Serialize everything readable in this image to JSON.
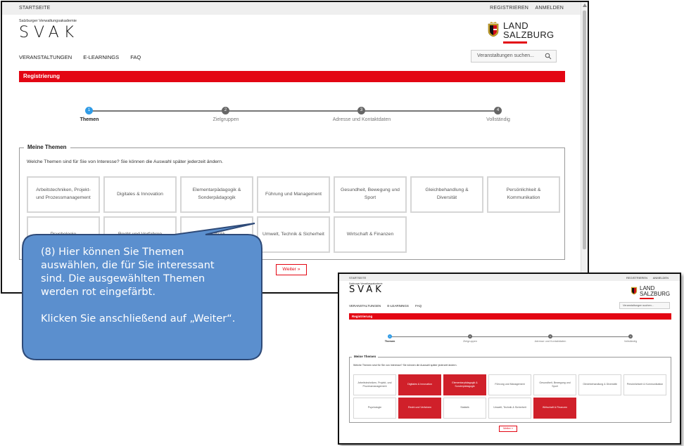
{
  "header": {
    "startseite": "STARTSEITE",
    "registrieren": "REGISTRIEREN",
    "anmelden": "ANMELDEN"
  },
  "logo": {
    "subtitle": "Salzburger Verwaltungsakademie",
    "svak": "SVAK",
    "land_line1": "LAND",
    "land_line2": "SALZBURG"
  },
  "nav": {
    "items": [
      "VERANSTALTUNGEN",
      "E-LEARNINGS",
      "FAQ"
    ]
  },
  "search": {
    "placeholder": "Veranstaltungen suchen..."
  },
  "page": {
    "section_title": "Registrierung"
  },
  "stepper": {
    "steps": [
      {
        "number": "1",
        "label": "Themen",
        "active": true
      },
      {
        "number": "2",
        "label": "Zielgruppen",
        "active": false
      },
      {
        "number": "3",
        "label": "Adresse und Kontaktdaten",
        "active": false
      },
      {
        "number": "4",
        "label": "Vollständig",
        "active": false
      }
    ]
  },
  "themes": {
    "legend": "Meine Themen",
    "intro": "Welche Themen sind für Sie von Interesse? Sie können die Auswahl später jederzeit ändern.",
    "tiles_row1": [
      {
        "label": "Arbeitstechniken, Projekt- und Prozessmanagement",
        "selected": false
      },
      {
        "label": "Digitales & Innovation",
        "selected": true
      },
      {
        "label": "Elementarpädagogik & Sonderpädagogik",
        "selected": true
      },
      {
        "label": "Führung und Management",
        "selected": false
      },
      {
        "label": "Gesundheit, Bewegung und Sport",
        "selected": false
      },
      {
        "label": "Gleichbehandlung & Diversität",
        "selected": false
      },
      {
        "label": "Persönlichkeit & Kommunikation",
        "selected": false
      }
    ],
    "tiles_row2": [
      {
        "label": "Psychologie",
        "selected": false
      },
      {
        "label": "Recht und Verfahren",
        "selected": true
      },
      {
        "label": "Statistik",
        "selected": false
      },
      {
        "label": "Umwelt, Technik & Sicherheit",
        "selected": false
      },
      {
        "label": "Wirtschaft & Finanzen",
        "selected": true
      }
    ],
    "weiter": "Weiter »"
  },
  "callout": {
    "paragraph1": "(8) Hier können Sie Themen auswählen, die für Sie interessant sind. Die ausgewählten Themen werden rot eingefärbt.",
    "paragraph2": "Klicken Sie anschließend auf „Weiter“.",
    "fill_color": "#5b8fce",
    "border_color": "#2e4a78"
  },
  "colors": {
    "brand_red": "#e30613",
    "selected_red": "#d0202a",
    "step_active": "#2f9be6"
  }
}
